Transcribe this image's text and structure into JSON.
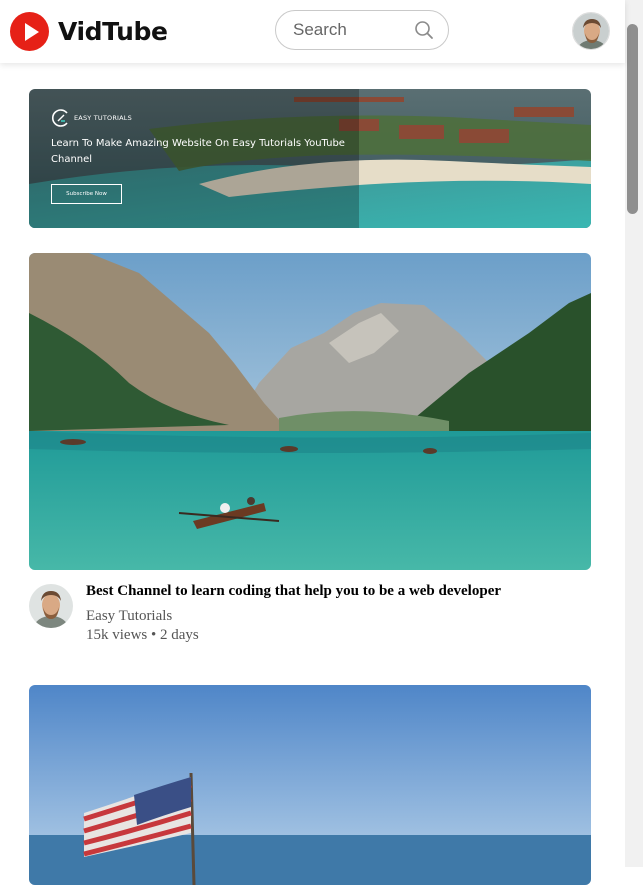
{
  "header": {
    "logo_text": "VidTube",
    "search_placeholder": "Search",
    "colors": {
      "logo_red": "#e62117"
    }
  },
  "icons": {
    "logo": "play-circle-icon",
    "search": "search-icon",
    "banner_brand": "easy-tutorials-logo-icon"
  },
  "banner": {
    "brand": "EASY TUTORIALS",
    "headline": "Learn To Make Amazing Website On Easy Tutorials YouTube Channel",
    "button_label": "Subscribe Now"
  },
  "videos": [
    {
      "title": "Best Channel to learn coding that help you to be a web developer",
      "channel": "Easy Tutorials",
      "stats": "15k views • 2 days"
    }
  ]
}
